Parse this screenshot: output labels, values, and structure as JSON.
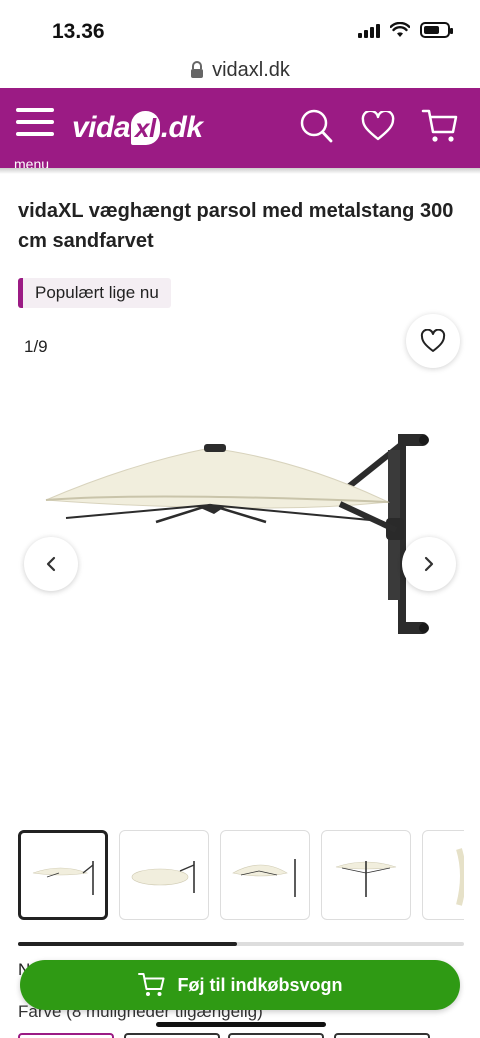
{
  "status_bar": {
    "time": "13.36",
    "battery_level": 0.7
  },
  "browser": {
    "url": "vidaxl.dk"
  },
  "header": {
    "menu_label": "menu",
    "logo": {
      "prefix": "vida",
      "mark": "xl",
      "suffix": ".dk"
    },
    "brand_color": "#9b1b84"
  },
  "product": {
    "title": "vidaXL væghængt parsol med metalstang 300 cm sandfarvet",
    "badge": "Populært lige nu",
    "image_counter": "1/9",
    "thumbnail_scroll_position": 0.49
  },
  "below_gallery": {
    "partial_label": "N",
    "color_label": "Farve (8 muligheder tilgængelig)"
  },
  "cart_button": {
    "label": "Føj til indkøbsvogn",
    "color": "#2f9a14"
  },
  "icons": [
    "menu-icon",
    "lock-icon",
    "search-icon",
    "heart-icon",
    "cart-icon",
    "chevron-left-icon",
    "chevron-right-icon"
  ]
}
